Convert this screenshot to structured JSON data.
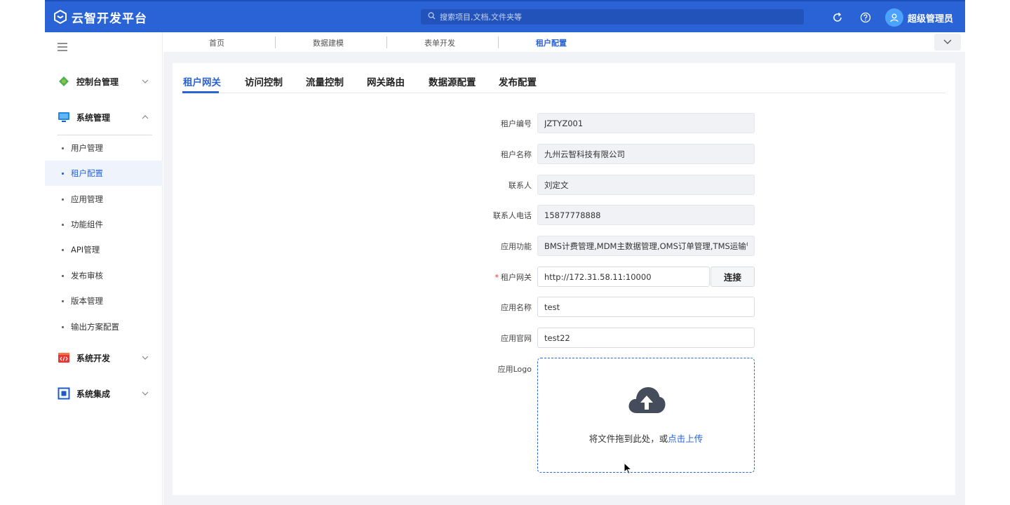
{
  "header": {
    "app_title": "云智开发平台",
    "search_placeholder": "搜索项目,文档,文件夹等",
    "user_name": "超级管理员"
  },
  "sidebar": {
    "groups": [
      {
        "label": "控制台管理",
        "icon": "console-icon",
        "expanded": false
      },
      {
        "label": "系统管理",
        "icon": "monitor-icon",
        "expanded": true
      },
      {
        "label": "系统开发",
        "icon": "code-icon",
        "expanded": false
      },
      {
        "label": "系统集成",
        "icon": "integration-icon",
        "expanded": false
      }
    ],
    "sub_items": [
      {
        "label": "用户管理",
        "active": false
      },
      {
        "label": "租户配置",
        "active": true
      },
      {
        "label": "应用管理",
        "active": false
      },
      {
        "label": "功能组件",
        "active": false
      },
      {
        "label": "API管理",
        "active": false
      },
      {
        "label": "发布审核",
        "active": false
      },
      {
        "label": "版本管理",
        "active": false
      },
      {
        "label": "输出方案配置",
        "active": false
      }
    ]
  },
  "topnav": {
    "items": [
      "首页",
      "数据建模",
      "表单开发",
      "租户配置"
    ],
    "active_index": 3
  },
  "tabs": {
    "items": [
      "租户网关",
      "访问控制",
      "流量控制",
      "网关路由",
      "数据源配置",
      "发布配置"
    ],
    "active_index": 0
  },
  "form": {
    "tenant_code": {
      "label": "租户编号",
      "value": "JZTYZ001"
    },
    "tenant_name": {
      "label": "租户名称",
      "value": "九州云智科技有限公司"
    },
    "contact": {
      "label": "联系人",
      "value": "刘定文"
    },
    "contact_phone": {
      "label": "联系人电话",
      "value": "15877778888"
    },
    "app_functions": {
      "label": "应用功能",
      "value": "BMS计费管理,MDM主数据管理,OMS订单管理,TMS运输管理"
    },
    "tenant_gateway": {
      "label": "租户网关",
      "required_mark": "*",
      "value": "http://172.31.58.11:10000",
      "connect_label": "连接"
    },
    "app_name": {
      "label": "应用名称",
      "value": "test"
    },
    "app_website": {
      "label": "应用官网",
      "value": "test22"
    },
    "app_logo": {
      "label": "应用Logo",
      "upload_text": "将文件拖到此处，或",
      "upload_link": "点击上传"
    }
  },
  "colors": {
    "primary": "#2a63d6",
    "header_bg": "#2a63d6",
    "required": "#e53935"
  }
}
